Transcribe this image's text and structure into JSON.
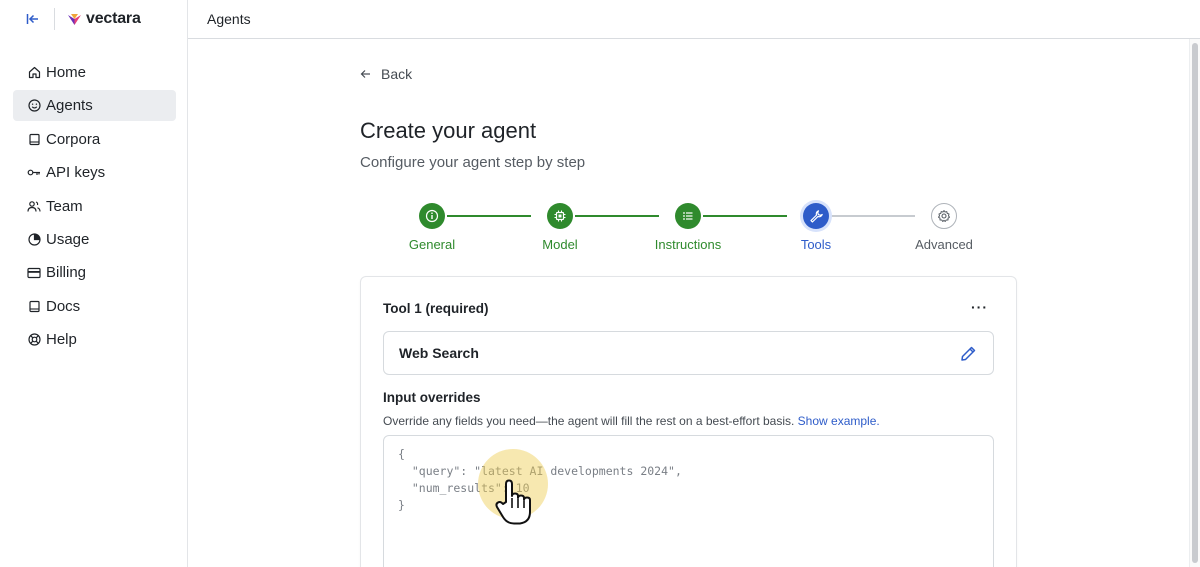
{
  "app": {
    "logo_text": "vectara",
    "collapse_icon": "collapse-sidebar-icon"
  },
  "sidebar": {
    "items": [
      {
        "label": "Home",
        "icon": "home-icon"
      },
      {
        "label": "Agents",
        "icon": "smiley-icon",
        "active": true
      },
      {
        "label": "Corpora",
        "icon": "book-icon"
      },
      {
        "label": "API keys",
        "icon": "key-icon"
      },
      {
        "label": "Team",
        "icon": "users-icon"
      },
      {
        "label": "Usage",
        "icon": "pie-chart-icon"
      },
      {
        "label": "Billing",
        "icon": "credit-card-icon"
      },
      {
        "label": "Docs",
        "icon": "book-icon"
      },
      {
        "label": "Help",
        "icon": "lifebuoy-icon"
      }
    ]
  },
  "header": {
    "title": "Agents"
  },
  "page": {
    "back_label": "Back",
    "title": "Create your agent",
    "subtitle": "Configure your agent step by step"
  },
  "stepper": {
    "steps": [
      {
        "label": "General",
        "state": "done",
        "icon": "info-icon"
      },
      {
        "label": "Model",
        "state": "done",
        "icon": "chip-icon"
      },
      {
        "label": "Instructions",
        "state": "done",
        "icon": "list-icon"
      },
      {
        "label": "Tools",
        "state": "current",
        "icon": "wrench-icon"
      },
      {
        "label": "Advanced",
        "state": "todo",
        "icon": "gear-icon"
      }
    ]
  },
  "tool_card": {
    "title": "Tool 1 (required)",
    "more_label": "···",
    "tool_name": "Web Search",
    "overrides_title": "Input overrides",
    "overrides_desc": "Override any fields you need—the agent will fill the rest on a best-effort basis.",
    "show_example_label": "Show example.",
    "code": "{\n  \"query\": \"latest AI developments 2024\",\n  \"num_results\": 10\n}"
  },
  "colors": {
    "done": "#2f8a2d",
    "current": "#2e5cc9",
    "todo": "#aeb3b9",
    "link": "#2e5cc9"
  }
}
